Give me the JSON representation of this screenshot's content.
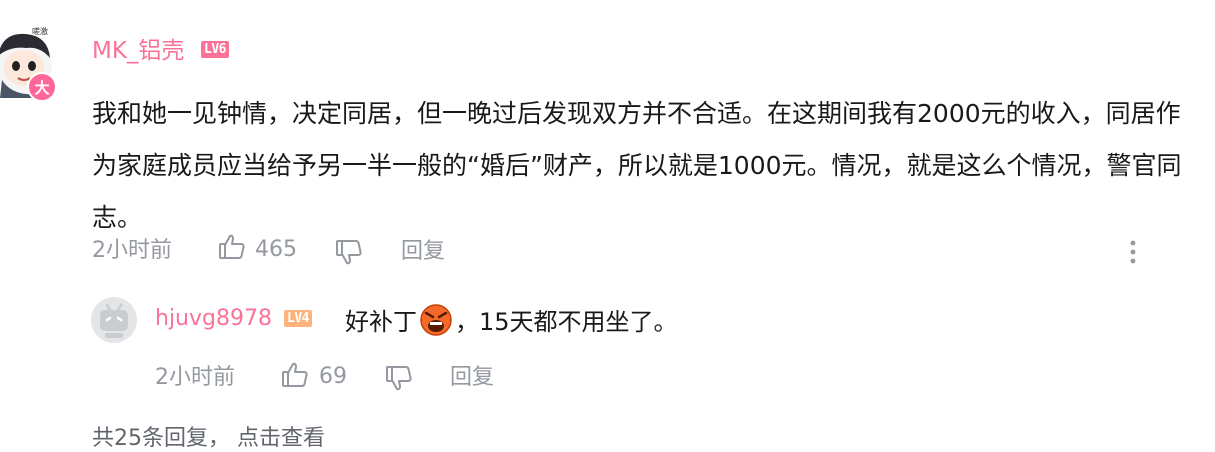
{
  "comment": {
    "username": "MK_铝壳",
    "level": "LV6",
    "avatar_badge": "大",
    "text": "我和她一见钟情，决定同居，但一晚过后发现双方并不合适。在这期间我有2000元的收入，同居作为家庭成员应当给予另一半一般的“婚后”财产，所以就是1000元。情况，就是这么个情况，警官同志。",
    "time": "2小时前",
    "like_count": "465",
    "reply_label": "回复",
    "icons": [
      "like-icon",
      "dislike-icon",
      "more-icon"
    ]
  },
  "reply": {
    "username": "hjuvg8978",
    "level": "LV4",
    "text_before_emoji": "好补丁",
    "emoji": "angry-face-emoji",
    "text_after_emoji": "，15天都不用坐了。",
    "time": "2小时前",
    "like_count": "69",
    "reply_label": "回复"
  },
  "footer": {
    "replies_summary": "共25条回复，",
    "view_link": "点击查看"
  },
  "colors": {
    "username": "#fb7299",
    "meta_gray": "#9499a0",
    "text": "#18191c",
    "lv6_badge": "#fb7299",
    "lv4_badge": "#ffb37c"
  }
}
